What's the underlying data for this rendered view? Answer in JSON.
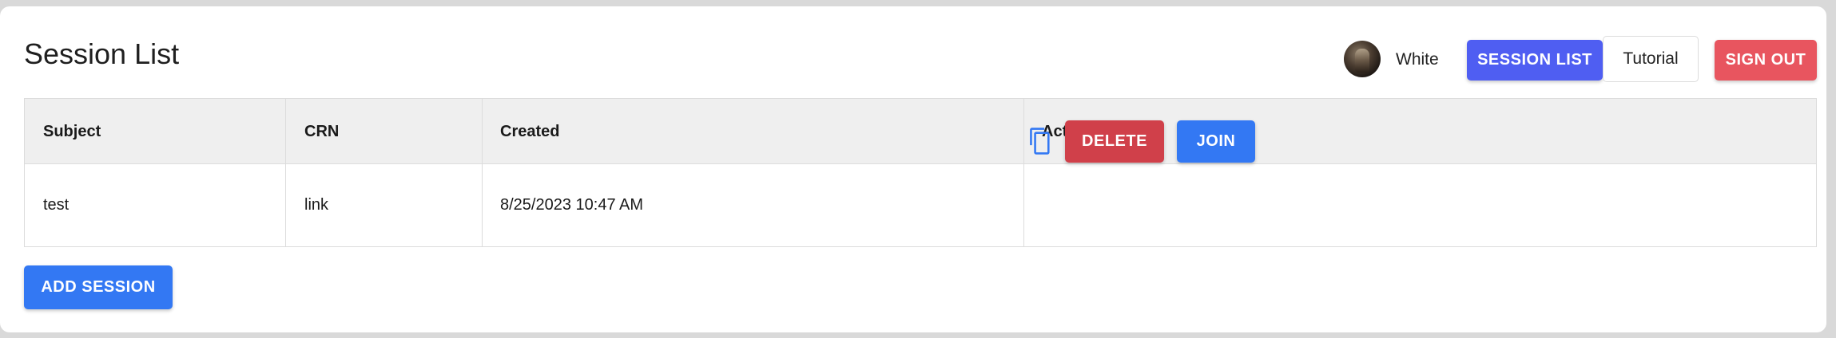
{
  "page_title": "Session List",
  "header": {
    "user_name": "White",
    "session_list_label": "SESSION LIST",
    "tutorial_label": "Tutorial",
    "sign_out_label": "SIGN OUT"
  },
  "table": {
    "columns": [
      "Subject",
      "CRN",
      "Created",
      "Action"
    ],
    "rows": [
      {
        "subject": "test",
        "crn": "link",
        "created": "8/25/2023 10:47 AM",
        "delete_label": "DELETE",
        "join_label": "JOIN"
      }
    ]
  },
  "add_session_label": "ADD SESSION",
  "colors": {
    "primary": "#3378f3",
    "session_list": "#4f5ef2",
    "danger": "#d0404a",
    "sign_out": "#e8555f"
  },
  "icons": {
    "copy": "copy-icon",
    "avatar": "avatar"
  }
}
